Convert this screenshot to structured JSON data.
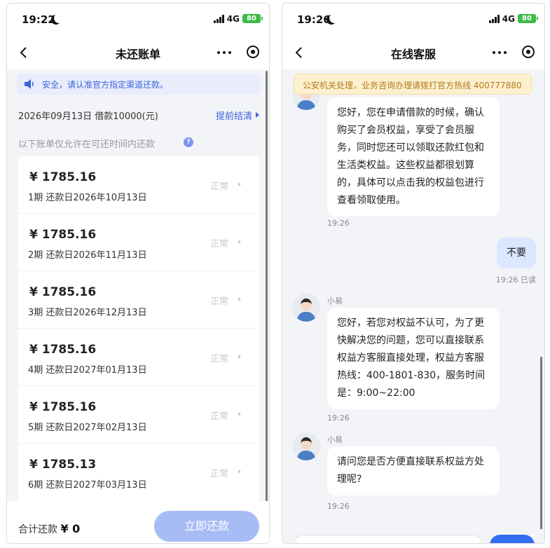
{
  "left": {
    "status": {
      "time": "19:22",
      "network": "4G",
      "battery": "80"
    },
    "nav": {
      "title": "未还账单"
    },
    "notice": {
      "text": "安全，请认准官方指定渠道还款。"
    },
    "loan": {
      "info": "2026年09月13日 借款10000(元)",
      "settle_label": "提前结清"
    },
    "hint": {
      "text": "以下账单仅允许在可还时间内还款",
      "help": "?"
    },
    "bills": [
      {
        "amount": "¥ 1785.16",
        "period": "1期  还款日2026年10月13日",
        "status": "正常"
      },
      {
        "amount": "¥ 1785.16",
        "period": "2期  还款日2026年11月13日",
        "status": "正常"
      },
      {
        "amount": "¥ 1785.16",
        "period": "3期  还款日2026年12月13日",
        "status": "正常"
      },
      {
        "amount": "¥ 1785.16",
        "period": "4期  还款日2027年01月13日",
        "status": "正常"
      },
      {
        "amount": "¥ 1785.16",
        "period": "5期  还款日2027年02月13日",
        "status": "正常"
      },
      {
        "amount": "¥ 1785.13",
        "period": "6期  还款日2027年03月13日",
        "status": "正常"
      }
    ],
    "footer": {
      "total_label": "合计还款",
      "total_value": "¥ 0",
      "pay_label": "立即还款"
    }
  },
  "right": {
    "status": {
      "time": "19:26",
      "network": "4G",
      "battery": "80"
    },
    "nav": {
      "title": "在线客服"
    },
    "banner": {
      "text": "公安机关处理，业务咨询办理请拨打官方热线 400777880"
    },
    "messages": {
      "m1": {
        "text": "您好，您在申请借款的时候，确认购买了会员权益，享受了会员服务，同时您还可以领取还款红包和生活类权益。这些权益都很划算的，具体可以点击我的权益包进行查看领取使用。",
        "time": "19:26"
      },
      "m2": {
        "text": "不要",
        "time": "19:26 已读"
      },
      "m3": {
        "sender": "小易",
        "text": "您好，若您对权益不认可，为了更快解决您的问题，您可以直接联系权益方客服直接处理，权益方客服热线：400-1801-830，服务时间是：9:00~22:00",
        "time": "19:26"
      },
      "m4": {
        "sender": "小易",
        "text": "请问您是否方便直接联系权益方处理呢?",
        "time": "19:26"
      }
    }
  },
  "colors": {
    "accent": "#3a63e0",
    "battery": "#3dbb45",
    "my_bubble": "#dbe6ff",
    "banner": "#fdf0cf"
  }
}
